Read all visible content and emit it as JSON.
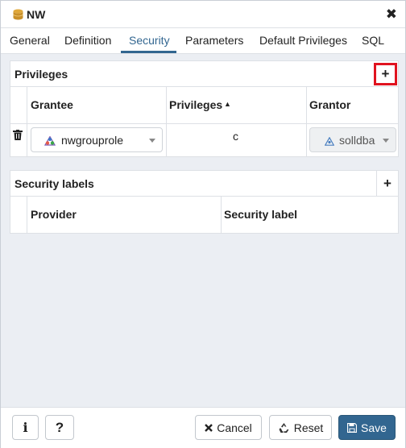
{
  "dialog": {
    "title": "NW",
    "close_glyph": "✖"
  },
  "tabs": [
    {
      "label": "General"
    },
    {
      "label": "Definition"
    },
    {
      "label": "Security",
      "active": true
    },
    {
      "label": "Parameters"
    },
    {
      "label": "Default Privileges"
    },
    {
      "label": "SQL"
    }
  ],
  "privileges": {
    "title": "Privileges",
    "add_glyph": "+",
    "columns": {
      "grantee": "Grantee",
      "privileges": "Privileges",
      "grantor": "Grantor"
    },
    "sort_glyph": "▲",
    "row": {
      "grantee": "nwgrouprole",
      "privileges": "c",
      "grantor": "solldba"
    }
  },
  "security_labels": {
    "title": "Security labels",
    "add_glyph": "+",
    "columns": {
      "provider": "Provider",
      "label": "Security label"
    }
  },
  "footer": {
    "info_glyph": "i",
    "help_glyph": "?",
    "cancel": "Cancel",
    "reset": "Reset",
    "save": "Save"
  },
  "colors": {
    "accent": "#326690",
    "highlight": "#e0131f",
    "background": "#ebeef3"
  },
  "icons": [
    "database-icon",
    "close-icon",
    "add-icon",
    "sort-asc-icon",
    "delete-icon",
    "group-role-icon",
    "role-icon",
    "caret-down-icon",
    "info-icon",
    "help-icon",
    "cancel-icon",
    "reset-icon",
    "save-icon"
  ]
}
